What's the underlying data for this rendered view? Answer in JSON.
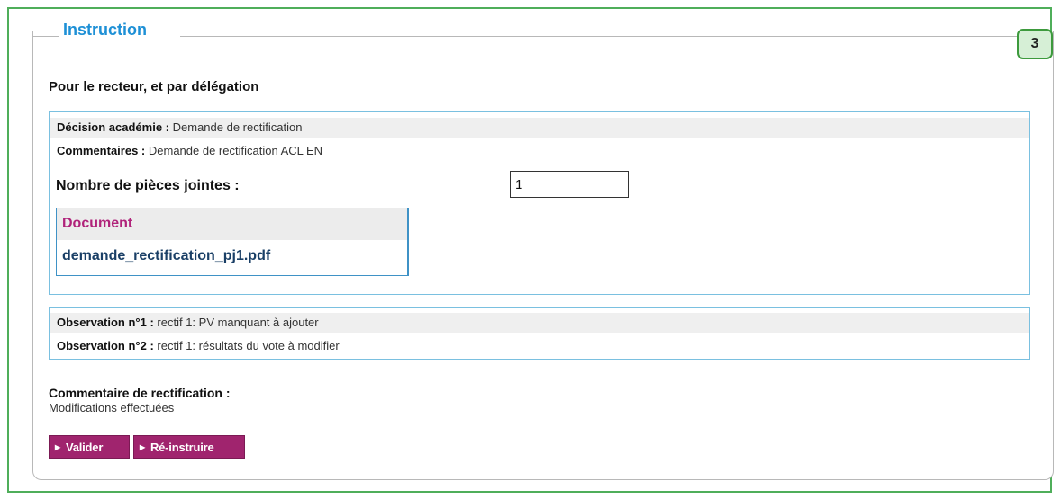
{
  "section": {
    "title": "Instruction",
    "step_number": "3",
    "signature_title": "Pour le recteur, et par délégation"
  },
  "decision": {
    "decision_label": "Décision académie :",
    "decision_value": "Demande de rectification",
    "comment_label": "Commentaires :",
    "comment_value": "Demande de rectification ACL EN",
    "attachments_label": "Nombre de pièces jointes :",
    "attachments_count": "1",
    "documents_header": "Document",
    "documents": [
      {
        "name": "demande_rectification_pj1.pdf"
      }
    ]
  },
  "observations": [
    {
      "label": "Observation n°1 :",
      "value": "rectif 1: PV manquant à ajouter"
    },
    {
      "label": "Observation n°2 :",
      "value": "rectif 1: résultats du vote à modifier"
    }
  ],
  "rectification": {
    "label": "Commentaire de rectification :",
    "value": "Modifications effectuées"
  },
  "actions": {
    "validate_label": "Valider",
    "reinstruct_label": "Ré-instruire"
  },
  "colors": {
    "frame_green": "#4fae5a",
    "title_blue": "#1e90d6",
    "box_border_blue": "#7ac0e0",
    "button_magenta": "#a0246e",
    "document_header_magenta": "#b0237a"
  }
}
